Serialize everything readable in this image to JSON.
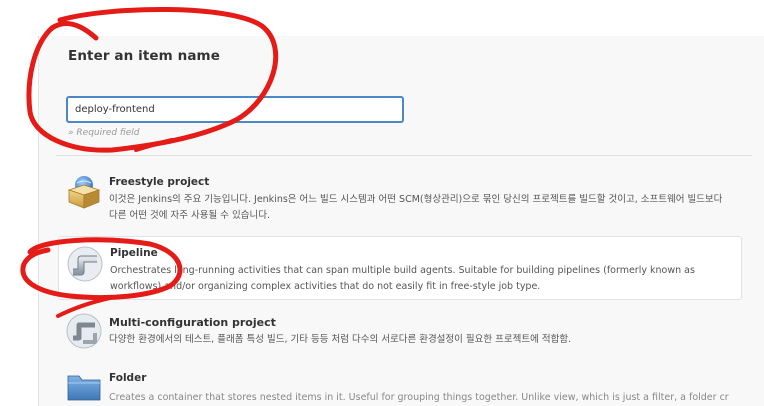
{
  "form": {
    "heading": "Enter an item name",
    "item_name_value": "deploy-frontend",
    "required_hint": "» Required field"
  },
  "item_types": [
    {
      "title": "Freestyle project",
      "description": "이것은 Jenkins의 주요 기능입니다. Jenkins은 어느 빌드 시스템과 어떤 SCM(형상관리)으로 묶인 당신의 프로젝트를 빌드할 것이고, 소프트웨어 빌드보다 다른 어떤 것에 자주 사용될 수 있습니다.",
      "icon": "freestyle-project-icon"
    },
    {
      "title": "Pipeline",
      "description": "Orchestrates long-running activities that can span multiple build agents. Suitable for building pipelines (formerly known as workflows) and/or organizing complex activities that do not easily fit in free-style job type.",
      "icon": "pipeline-icon",
      "selected": true
    },
    {
      "title": "Multi-configuration project",
      "description": "다양한 환경에서의 테스트, 플래폼 특성 빌드, 기타 등등 처럼 다수의 서로다른 환경설정이 필요한 프로젝트에 적합함.",
      "icon": "multi-configuration-icon"
    },
    {
      "title": "Folder",
      "description": "Creates a container that stores nested items in it. Useful for grouping things together. Unlike view, which is just a filter, a folder creates a",
      "icon": "folder-icon"
    }
  ],
  "colors": {
    "annotation": "#e41b17",
    "input_border": "#4a88c8",
    "panel_bg": "#f8f8f9"
  }
}
